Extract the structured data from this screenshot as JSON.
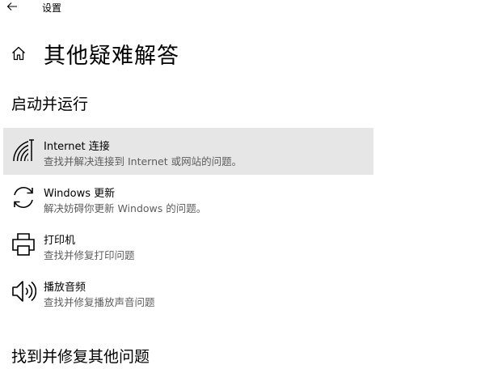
{
  "window": {
    "title": "设置"
  },
  "header": {
    "title": "其他疑难解答"
  },
  "sections": [
    {
      "title": "启动并运行",
      "items": [
        {
          "icon": "wifi-icon",
          "title": "Internet 连接",
          "description": "查找并解决连接到 Internet 或网站的问题。",
          "selected": true
        },
        {
          "icon": "refresh-icon",
          "title": "Windows 更新",
          "description": "解决妨碍你更新 Windows 的问题。",
          "selected": false
        },
        {
          "icon": "printer-icon",
          "title": "打印机",
          "description": "查找并修复打印问题",
          "selected": false
        },
        {
          "icon": "speaker-icon",
          "title": "播放音频",
          "description": "查找并修复播放声音问题",
          "selected": false
        }
      ]
    },
    {
      "title": "找到并修复其他问题"
    }
  ],
  "colors": {
    "selected_background": "#e6e6e6",
    "description_text": "#5d5d5d"
  }
}
